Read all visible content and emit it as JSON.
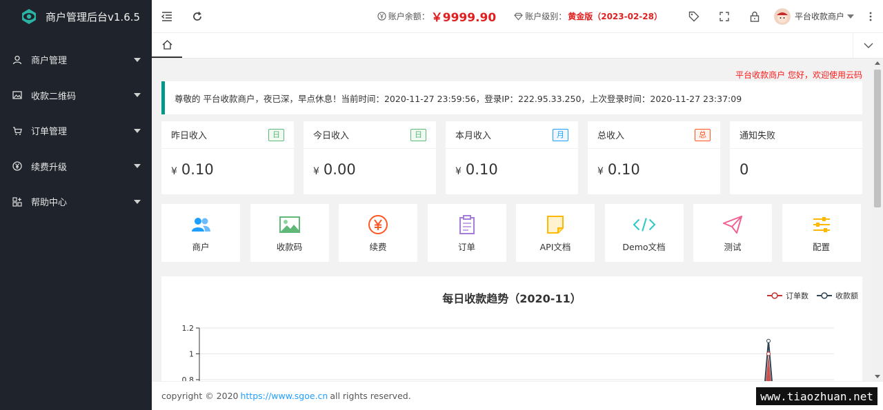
{
  "brand": {
    "title": "商户管理后台v1.6.5",
    "logo_icon": "eye-logo-icon"
  },
  "sidebar": {
    "items": [
      {
        "label": "商户管理",
        "icon": "user-icon"
      },
      {
        "label": "收款二维码",
        "icon": "image-icon"
      },
      {
        "label": "订单管理",
        "icon": "cart-icon"
      },
      {
        "label": "续费升级",
        "icon": "yen-circle-icon"
      },
      {
        "label": "帮助中心",
        "icon": "apps-icon"
      }
    ]
  },
  "header": {
    "balance_label": "账户余额：",
    "balance_value": "￥9999.90",
    "level_label": "账户级别：",
    "level_value": "黄金版（2023-02-28）",
    "user_name": "平台收款商户",
    "colors": {
      "accent_red": "#e02020",
      "sidebar_bg": "#1f232b",
      "notice_border": "#009688"
    }
  },
  "marquee": "平台收款商户 您好，欢迎使用云码",
  "notice": "尊敬的 平台收款商户，夜已深，早点休息！当前时间：2020-11-27 23:59:56，登录IP：222.95.33.250，上次登录时间：2020-11-27 23:37:09",
  "stats": [
    {
      "label": "昨日收入",
      "badge": "日",
      "currency": "¥",
      "value": "0.10"
    },
    {
      "label": "今日收入",
      "badge": "日",
      "currency": "¥",
      "value": "0.00"
    },
    {
      "label": "本月收入",
      "badge": "月",
      "currency": "¥",
      "value": "0.10"
    },
    {
      "label": "总收入",
      "badge": "总",
      "currency": "¥",
      "value": "0.10"
    },
    {
      "label": "通知失败",
      "badge": "",
      "currency": "",
      "value": "0"
    }
  ],
  "shortcuts": [
    {
      "label": "商户",
      "icon": "users-icon",
      "color": "#1e9fff"
    },
    {
      "label": "收款码",
      "icon": "picture-icon",
      "color": "#5fb878"
    },
    {
      "label": "续费",
      "icon": "yen-icon",
      "color": "#ff5722"
    },
    {
      "label": "订单",
      "icon": "clipboard-icon",
      "color": "#a57cd9"
    },
    {
      "label": "API文档",
      "icon": "note-icon",
      "color": "#ffb800"
    },
    {
      "label": "Demo文档",
      "icon": "code-icon",
      "color": "#2fc8c8"
    },
    {
      "label": "测试",
      "icon": "send-icon",
      "color": "#f06292"
    },
    {
      "label": "配置",
      "icon": "sliders-icon",
      "color": "#ffb800"
    }
  ],
  "chart_data": {
    "type": "line",
    "title": "每日收款趋势（2020-11）",
    "series": [
      {
        "name": "订单数",
        "color": "#c23531"
      },
      {
        "name": "收款额",
        "color": "#2f4554"
      }
    ],
    "yticks": [
      1.2,
      1,
      0.8
    ],
    "ylim_visible": [
      0.8,
      1.2
    ],
    "peaks": {
      "订单数": 1,
      "收款额": 1.1
    },
    "legend_position": "top-right",
    "grid": true
  },
  "footer": {
    "copyright": "copyright © 2020",
    "link_text": "https://www.sgoe.cn",
    "suffix": "all rights reserved."
  },
  "watermark": "www.tiaozhuan.net"
}
